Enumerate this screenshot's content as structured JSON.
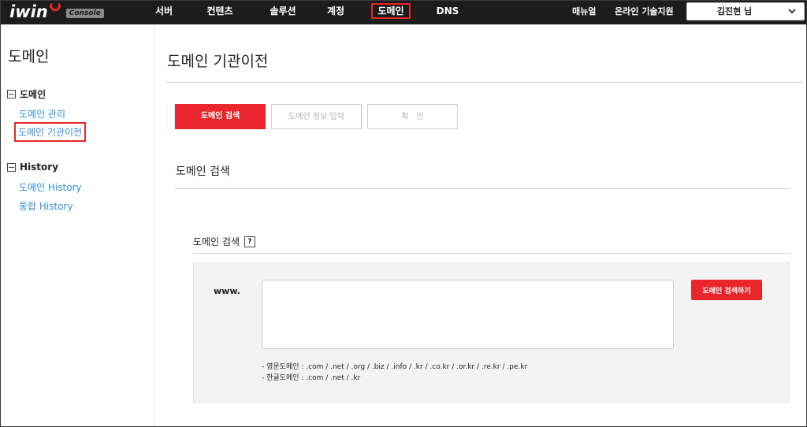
{
  "header": {
    "logo_text": "iwin",
    "logo_badge": "Console",
    "nav": [
      {
        "label": "서버",
        "active": false
      },
      {
        "label": "컨텐츠",
        "active": false
      },
      {
        "label": "솔루션",
        "active": false
      },
      {
        "label": "계정",
        "active": false
      },
      {
        "label": "도메인",
        "active": true
      },
      {
        "label": "DNS",
        "active": false
      }
    ],
    "utility": {
      "manual": "매뉴얼",
      "support": "온라인 기술지원"
    },
    "user": {
      "name": "김진현 님",
      "dropdown_icon": "chevron-down-icon"
    }
  },
  "sidebar": {
    "title": "도메인",
    "groups": [
      {
        "label": "도메인",
        "icon": "collapse-box-icon",
        "items": [
          {
            "label": "도메인 관리",
            "current": false
          },
          {
            "label": "도메인 기관이전",
            "current": true
          }
        ]
      },
      {
        "label": "History",
        "icon": "collapse-box-icon",
        "items": [
          {
            "label": "도메인 History",
            "current": false
          },
          {
            "label": "통합 History",
            "current": false
          }
        ]
      }
    ]
  },
  "main": {
    "page_title": "도메인 기관이전",
    "steps": [
      {
        "label": "도메인 검색",
        "active": true
      },
      {
        "label": "도메인 정보 입력",
        "active": false
      },
      {
        "label": "확　인",
        "active": false
      }
    ],
    "section_title": "도메인 검색",
    "search": {
      "title": "도메인 검색",
      "help_label": "?",
      "prefix": "www.",
      "input_value": "",
      "button_label": "도메인 검색하기",
      "notes": [
        "- 영문도메인 : .com / .net / .org / .biz / .info / .kr / .co.kr / .or.kr / .re.kr / .pe.kr",
        "- 한글도메인 : .com / .net / .kr"
      ]
    }
  },
  "colors": {
    "accent": "#e8262b",
    "link": "#2f8fdb",
    "topbar": "#1c1c1c"
  }
}
